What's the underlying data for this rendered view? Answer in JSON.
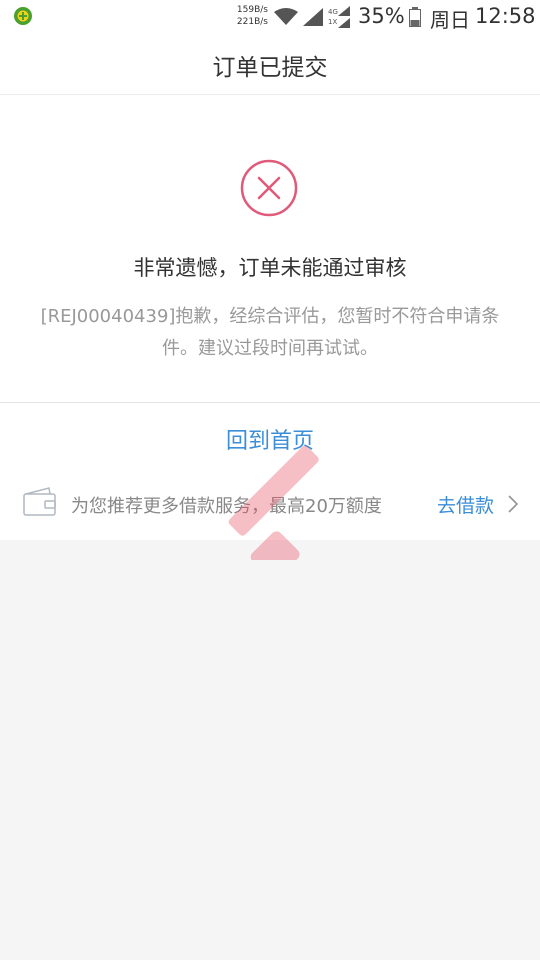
{
  "status_bar": {
    "net_speed_up": "159B/s",
    "net_speed_down": "221B/s",
    "battery": "35%",
    "day": "周日",
    "time": "12:58"
  },
  "header": {
    "title": "订单已提交"
  },
  "result": {
    "heading": "非常遗憾，订单未能通过审核",
    "message": "[REJ00040439]抱歉，经综合评估，您暂时不符合申请条件。建议过段时间再试试。"
  },
  "actions": {
    "home_link": "回到首页"
  },
  "promo": {
    "text": "为您推荐更多借款服务，最高20万额度",
    "link": "去借款"
  },
  "colors": {
    "accent": "#3d8ed8",
    "error": "#e05a7a"
  }
}
